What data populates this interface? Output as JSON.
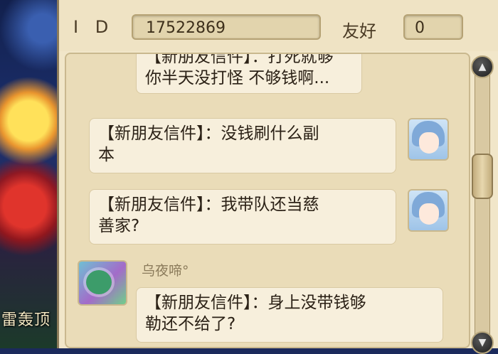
{
  "scene": {
    "caption": "雷轰顶"
  },
  "header": {
    "id_label": "I D",
    "id_value": "17522869",
    "friendship_label": "友好",
    "friendship_value": "0"
  },
  "messages": [
    {
      "side": "right",
      "text_line1": "【新朋友信件】：打死就够",
      "text_line2": "你半天没打怪 不够钱啊...",
      "avatar": "girl-avatar"
    },
    {
      "side": "right",
      "text_line1": "【新朋友信件】：没钱刷什么副",
      "text_line2": "本",
      "avatar": "girl-avatar"
    },
    {
      "side": "right",
      "text_line1": "【新朋友信件】：我带队还当慈",
      "text_line2": "善家?",
      "avatar": "girl-avatar"
    },
    {
      "side": "left",
      "sender": "乌夜啼°",
      "text_line1": "【新朋友信件】：身上没带钱够",
      "text_line2": "勒还不给了?",
      "avatar": "friend-avatar"
    }
  ],
  "scrollbar": {
    "up_icon": "▲",
    "down_icon": "▼"
  }
}
